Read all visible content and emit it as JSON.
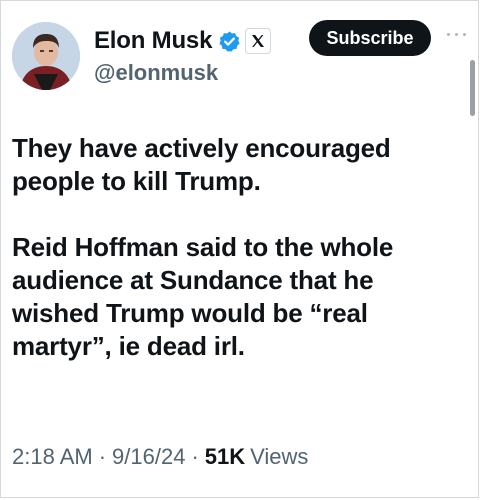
{
  "author": {
    "display_name": "Elon Musk",
    "handle": "@elonmusk"
  },
  "icons": {
    "verified": "verified-badge-icon",
    "affiliate": "x-logo-icon",
    "more": "more-horizontal-icon"
  },
  "colors": {
    "verified": "#1d9bf0",
    "text": "#0f1419",
    "secondary": "#536471",
    "button_bg": "#0f1419"
  },
  "actions": {
    "subscribe_label": "Subscribe"
  },
  "tweet": {
    "paragraphs": [
      "They have actively encouraged people to kill Trump.",
      "Reid Hoffman said to the whole audience at Sundance that he wished Trump would be “real martyr”, ie dead irl."
    ],
    "time": "2:18 AM",
    "date": "9/16/24",
    "views_count": "51K",
    "views_label": "Views",
    "separator": "·"
  }
}
